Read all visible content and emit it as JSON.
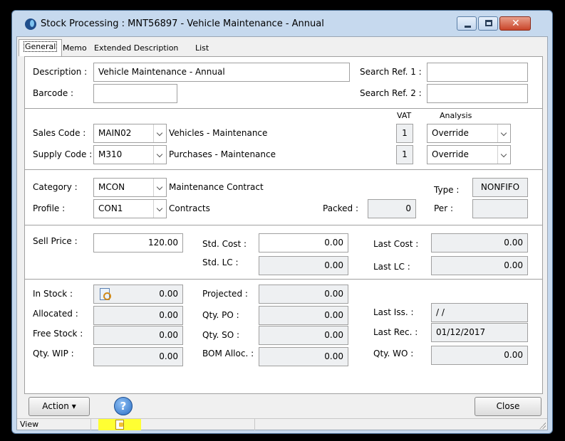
{
  "window": {
    "title": "Stock Processing : MNT56897 - Vehicle Maintenance  - Annual"
  },
  "tabs": [
    "General",
    "Memo",
    "Extended Description",
    "List"
  ],
  "general": {
    "description_label": "Description :",
    "description_value": "Vehicle Maintenance  - Annual",
    "barcode_label": "Barcode :",
    "barcode_value": "",
    "search_ref1_label": "Search Ref. 1 :",
    "search_ref1_value": "",
    "search_ref2_label": "Search Ref. 2 :",
    "search_ref2_value": "",
    "vat_header": "VAT",
    "analysis_header": "Analysis",
    "sales_code_label": "Sales Code :",
    "sales_code_value": "MAIN02",
    "sales_code_desc": "Vehicles - Maintenance",
    "sales_vat": "1",
    "sales_analysis": "Override",
    "supply_code_label": "Supply Code :",
    "supply_code_value": "M310",
    "supply_code_desc": "Purchases - Maintenance",
    "supply_vat": "1",
    "supply_analysis": "Override",
    "category_label": "Category :",
    "category_value": "MCON",
    "category_desc": "Maintenance Contract",
    "type_label": "Type :",
    "type_value": "NONFIFO",
    "profile_label": "Profile :",
    "profile_value": "CON1",
    "profile_desc": "Contracts",
    "packed_label": "Packed :",
    "packed_value": "0",
    "per_label": "Per :",
    "per_value": "",
    "sell_price_label": "Sell Price :",
    "sell_price_value": "120.00",
    "std_cost_label": "Std. Cost :",
    "std_cost_value": "0.00",
    "last_cost_label": "Last Cost :",
    "last_cost_value": "0.00",
    "std_lc_label": "Std. LC :",
    "std_lc_value": "0.00",
    "last_lc_label": "Last LC :",
    "last_lc_value": "0.00",
    "in_stock_label": "In Stock :",
    "in_stock_value": "0.00",
    "projected_label": "Projected :",
    "projected_value": "0.00",
    "allocated_label": "Allocated :",
    "allocated_value": "0.00",
    "qty_po_label": "Qty. PO :",
    "qty_po_value": "0.00",
    "last_iss_label": "Last Iss. :",
    "last_iss_value": "/ /",
    "free_stock_label": "Free Stock :",
    "free_stock_value": "0.00",
    "qty_so_label": "Qty. SO :",
    "qty_so_value": "0.00",
    "last_rec_label": "Last Rec. :",
    "last_rec_value": "01/12/2017",
    "qty_wip_label": "Qty. WIP :",
    "qty_wip_value": "0.00",
    "bom_alloc_label": "BOM Alloc. :",
    "bom_alloc_value": "0.00",
    "qty_wo_label": "Qty. WO :",
    "qty_wo_value": "0.00"
  },
  "footer": {
    "action_label": "Action",
    "help_glyph": "?",
    "close_label": "Close"
  },
  "status": {
    "mode": "View",
    "highlight_color": "#ffff33"
  }
}
